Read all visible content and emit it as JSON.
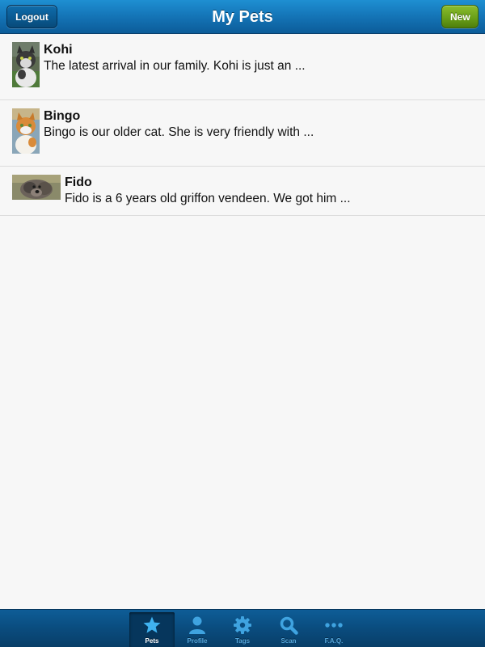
{
  "header": {
    "title": "My Pets",
    "logout_label": "Logout",
    "new_label": "New"
  },
  "pets": [
    {
      "name": "Kohi",
      "description": "The latest arrival in our family. Kohi is just an ...",
      "photo": "cat-photo"
    },
    {
      "name": "Bingo",
      "description": "Bingo is our older cat. She is very friendly with ...",
      "photo": "cat-photo"
    },
    {
      "name": "Fido",
      "description": "Fido is a 6 years old griffon vendeen. We got him ...",
      "photo": "dog-photo"
    }
  ],
  "tabs": [
    {
      "label": "Pets",
      "icon": "star-icon",
      "active": true
    },
    {
      "label": "Profile",
      "icon": "person-icon",
      "active": false
    },
    {
      "label": "Tags",
      "icon": "gear-icon",
      "active": false
    },
    {
      "label": "Scan",
      "icon": "search-icon",
      "active": false
    },
    {
      "label": "F.A.Q.",
      "icon": "more-dots-icon",
      "active": false
    }
  ],
  "colors": {
    "header_blue": "#1474b6",
    "new_green": "#6aa019",
    "tab_inactive_label": "#57a7db",
    "tab_icon": "#3fa3e0"
  }
}
